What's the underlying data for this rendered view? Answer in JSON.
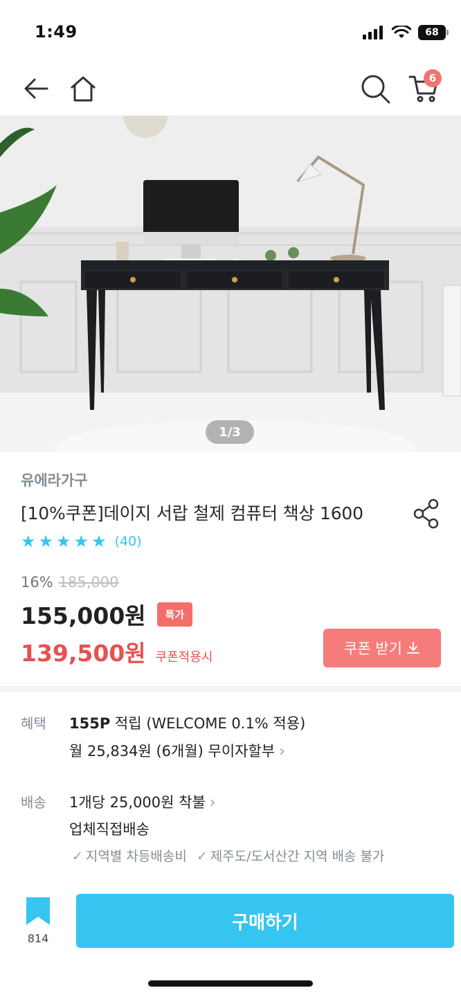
{
  "status_bar": {
    "time": "1:49",
    "battery": "68"
  },
  "nav": {
    "cart_badge": "6"
  },
  "hero": {
    "pager": "1/3"
  },
  "product": {
    "brand": "유에라가구",
    "title": "[10%쿠폰]데이지 서랍 철제 컴퓨터 책상 1600",
    "rating": 5,
    "review_count": "(40)",
    "discount_rate": "16%",
    "original_price": "185,000",
    "price": "155,000원",
    "special_badge": "특가",
    "coupon_price": "139,500원",
    "coupon_note": "쿠폰적용시",
    "coupon_button": "쿠폰 받기"
  },
  "benefit": {
    "label": "혜택",
    "points_bold": "155P",
    "points_rest": " 적립 (WELCOME 0.1% 적용)",
    "installment": "월 25,834원 (6개월) 무이자할부"
  },
  "delivery": {
    "label": "배송",
    "fee": "1개당 25,000원 착불",
    "method": "업체직접배송",
    "notes": [
      "지역별 차등배송비",
      "제주도/도서산간 지역 배송 불가"
    ]
  },
  "bottom": {
    "bookmark_count": "814",
    "buy_label": "구매하기"
  },
  "colors": {
    "accent": "#35c5f0",
    "coupon": "#e85050",
    "badge": "#f46e6b"
  }
}
